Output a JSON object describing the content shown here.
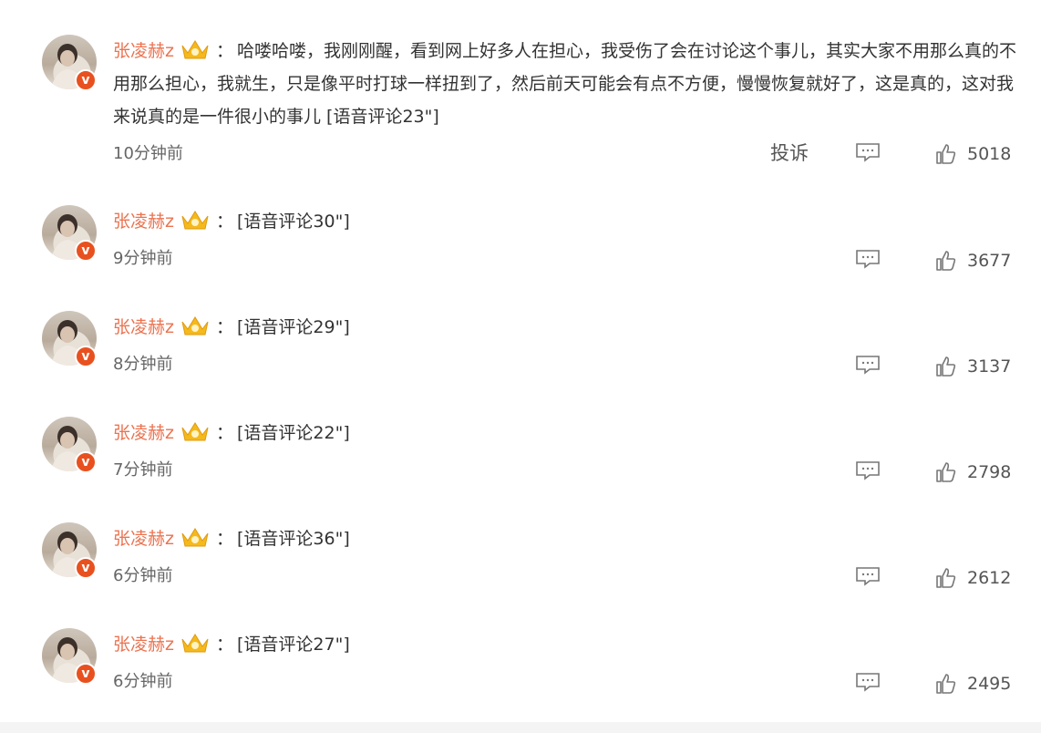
{
  "comments": [
    {
      "username": "张凌赫z",
      "text": "哈喽哈喽，我刚刚醒，看到网上好多人在担心，我受伤了会在讨论这个事儿，其实大家不用那么真的不用那么担心，我就生，只是像平时打球一样扭到了，然后前天可能会有点不方便，慢慢恢复就好了，这是真的，这对我来说真的是一件很小的事儿 [语音评论23\"]",
      "time": "10分钟前",
      "report": "投诉",
      "likes": "5018"
    },
    {
      "username": "张凌赫z",
      "text": "[语音评论30\"]",
      "time": "9分钟前",
      "likes": "3677"
    },
    {
      "username": "张凌赫z",
      "text": "[语音评论29\"]",
      "time": "8分钟前",
      "likes": "3137"
    },
    {
      "username": "张凌赫z",
      "text": "[语音评论22\"]",
      "time": "7分钟前",
      "likes": "2798"
    },
    {
      "username": "张凌赫z",
      "text": "[语音评论36\"]",
      "time": "6分钟前",
      "likes": "2612"
    },
    {
      "username": "张凌赫z",
      "text": "[语音评论27\"]",
      "time": "6分钟前",
      "likes": "2495"
    }
  ],
  "icons": {
    "verified": "verified-badge-icon",
    "crown": "crown-icon",
    "comment": "comment-icon",
    "like": "thumbs-up-icon"
  },
  "colors": {
    "username": "#eb7350",
    "verified": "#e8511f",
    "crown": "#f5b91c"
  },
  "verified_symbol": "v",
  "colon": "："
}
